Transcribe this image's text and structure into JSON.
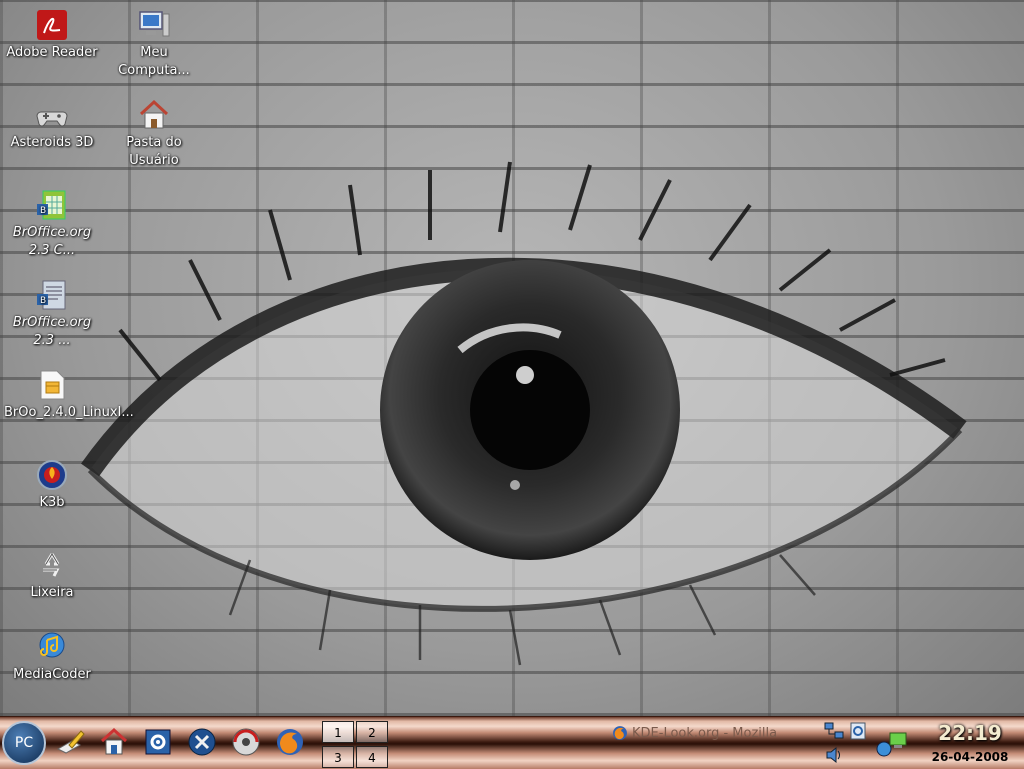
{
  "desktop_icons": [
    {
      "label": "Adobe Reader",
      "icon": "adobe-reader-icon"
    },
    {
      "label": "Meu Computa...",
      "icon": "computer-icon"
    },
    {
      "label": "Asteroids 3D",
      "icon": "gamepad-icon"
    },
    {
      "label": "Pasta do Usuário",
      "icon": "home-folder-icon"
    },
    {
      "label": "BrOffice.org 2.3 C...",
      "icon": "calc-spreadsheet-icon"
    },
    {
      "label": "BrOffice.org 2.3 ...",
      "icon": "writer-document-icon"
    },
    {
      "label": "BrOo_2.4.0_LinuxI...",
      "icon": "package-file-icon"
    },
    {
      "label": "K3b",
      "icon": "k3b-disc-icon"
    },
    {
      "label": "Lixeira",
      "icon": "trash-icon"
    },
    {
      "label": "MediaCoder",
      "icon": "mediacoder-icon"
    }
  ],
  "taskbar": {
    "start_label": "PC",
    "quick_launch": [
      "edit-pencil-icon",
      "home-icon",
      "settings-panel-icon",
      "tools-icon",
      "disc-burner-icon",
      "firefox-icon"
    ],
    "pager": [
      "1",
      "2",
      "3",
      "4"
    ],
    "task_title": "KDE-Look.org - Mozilla",
    "tray_icons": [
      "network-icon",
      "notes-icon",
      "volume-icon",
      "network-connection-icon"
    ]
  },
  "clock": {
    "time": "22:19",
    "date": "26-04-2008"
  },
  "colors": {
    "taskbar_copper": "#c48c76",
    "start_blue": "#1b3d66",
    "clock_text": "#f4ecd0"
  }
}
